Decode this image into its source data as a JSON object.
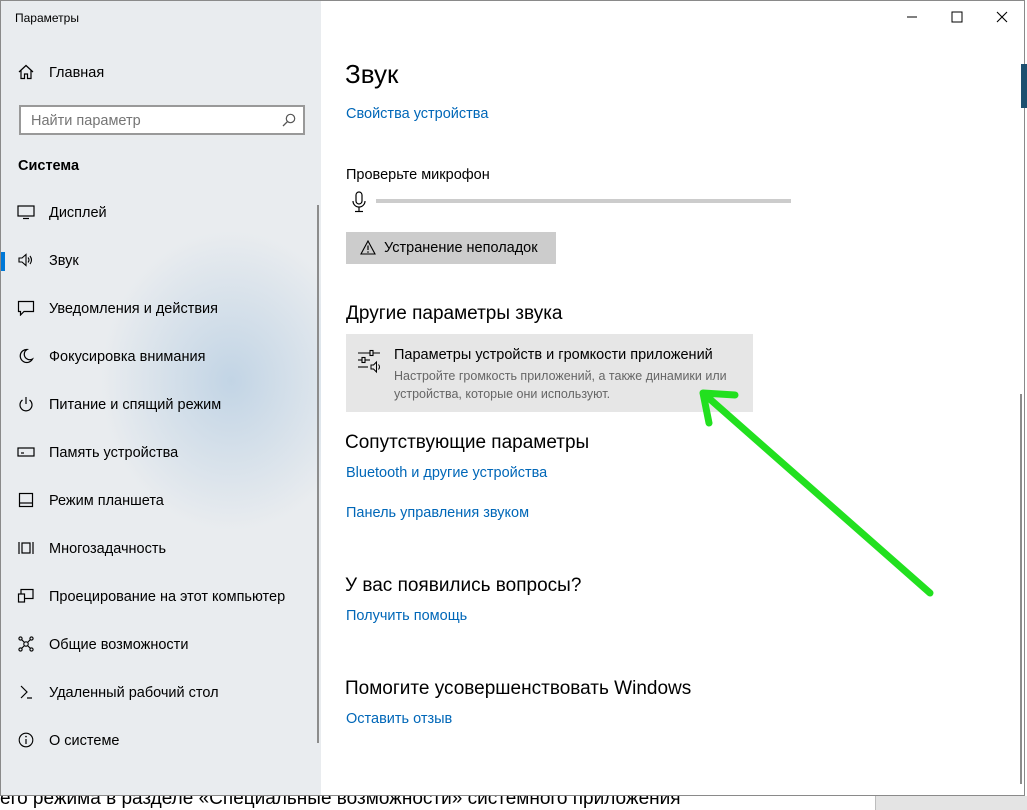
{
  "window": {
    "app_title": "Параметры",
    "controls": {
      "minimize": "—",
      "maximize": "☐",
      "close": "✕"
    }
  },
  "sidebar": {
    "home_label": "Главная",
    "search_placeholder": "Найти параметр",
    "section_title": "Система",
    "items": [
      {
        "label": "Дисплей",
        "icon": "display-icon"
      },
      {
        "label": "Звук",
        "icon": "speaker-icon",
        "active": true
      },
      {
        "label": "Уведомления и действия",
        "icon": "notifications-icon"
      },
      {
        "label": "Фокусировка внимания",
        "icon": "moon-icon"
      },
      {
        "label": "Питание и спящий режим",
        "icon": "power-icon"
      },
      {
        "label": "Память устройства",
        "icon": "storage-icon"
      },
      {
        "label": "Режим планшета",
        "icon": "tablet-icon"
      },
      {
        "label": "Многозадачность",
        "icon": "multitasking-icon"
      },
      {
        "label": "Проецирование на этот компьютер",
        "icon": "projecting-icon"
      },
      {
        "label": "Общие возможности",
        "icon": "shared-experiences-icon"
      },
      {
        "label": "Удаленный рабочий стол",
        "icon": "remote-desktop-icon"
      },
      {
        "label": "О системе",
        "icon": "info-icon"
      }
    ]
  },
  "main": {
    "title": "Звук",
    "device_properties_link": "Свойства устройства",
    "mic_test_label": "Проверьте микрофон",
    "troubleshoot_button": "Устранение неполадок",
    "other_sound_heading": "Другие параметры звука",
    "app_volume": {
      "title": "Параметры устройств и громкости приложений",
      "description": "Настройте громкость приложений, а также динамики или устройства, которые они используют."
    },
    "related_heading": "Сопутствующие параметры",
    "related_links": [
      "Bluetooth и другие устройства",
      "Панель управления звуком"
    ],
    "questions_heading": "У вас появились вопросы?",
    "help_link": "Получить помощь",
    "improve_heading": "Помогите усовершенствовать Windows",
    "feedback_link": "Оставить отзыв"
  },
  "annotation": {
    "arrow_color": "#22e01f"
  },
  "background_text": "его режима в разделе «Специальные возможности» системного приложения",
  "colors": {
    "accent": "#0078d7",
    "link": "#0067b8",
    "sidebar_bg": "#e9ecef"
  }
}
